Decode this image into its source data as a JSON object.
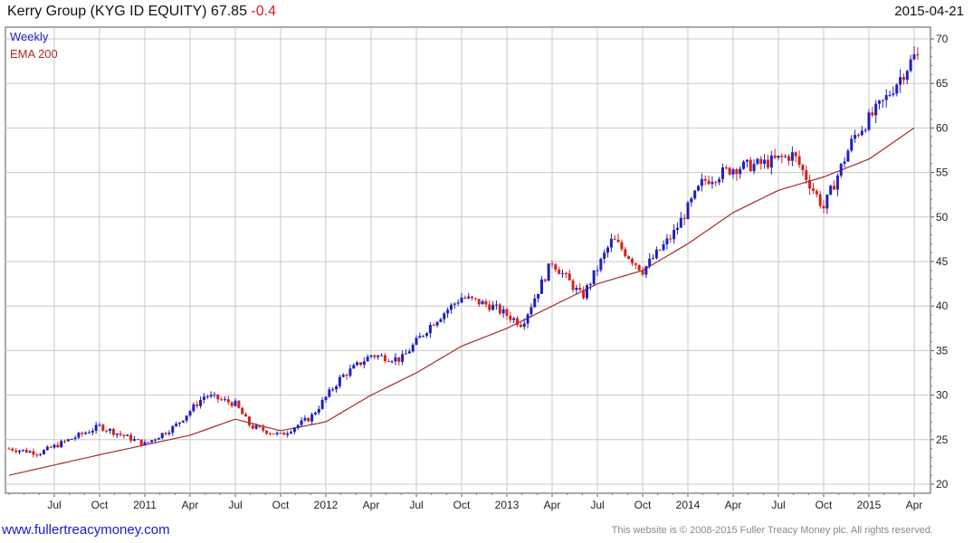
{
  "header": {
    "symbol_text": "Kerry Group (KYG ID EQUITY) 67.85",
    "change_text": "-0.4",
    "date": "2015-04-21"
  },
  "footer": {
    "website": "www.fullertreacymoney.com",
    "copyright": "This website is © 2008-2015 Fuller Treacy Money plc. All rights reserved."
  },
  "colors": {
    "up_candle": "#1f1fbf",
    "down_candle": "#d42020",
    "ema_line": "#a52a2a",
    "grid": "#c8c8c8",
    "frame": "#555555"
  },
  "chart_data": {
    "type": "candlestick",
    "title": "Kerry Group (KYG ID EQUITY) 67.85 -0.4",
    "frequency": "Weekly",
    "legend": [
      {
        "name": "Weekly",
        "color": "#1f1fbf"
      },
      {
        "name": "EMA 200",
        "color": "#a52a2a"
      }
    ],
    "legend_position": "top-left",
    "grid": true,
    "y_axis_side": "right",
    "ylim": [
      20,
      70
    ],
    "yticks": [
      20,
      25,
      30,
      35,
      40,
      45,
      50,
      55,
      60,
      65,
      70
    ],
    "x_tick_labels": [
      "Jul",
      "Oct",
      "2011",
      "Apr",
      "Jul",
      "Oct",
      "2012",
      "Apr",
      "Jul",
      "Oct",
      "2013",
      "Apr",
      "Jul",
      "Oct",
      "2014",
      "Apr",
      "Jul",
      "Oct",
      "2015",
      "Apr"
    ],
    "x_start": "2010-04",
    "x_end": "2015-04",
    "series": [
      {
        "name": "Weekly",
        "kind": "price_close_anchors",
        "dates": [
          "2010-04",
          "2010-06",
          "2010-08",
          "2010-10",
          "2011-01",
          "2011-03",
          "2011-05",
          "2011-07",
          "2011-08",
          "2011-10",
          "2011-12",
          "2012-02",
          "2012-04",
          "2012-06",
          "2012-08",
          "2012-10",
          "2012-12",
          "2013-02",
          "2013-04",
          "2013-06",
          "2013-08",
          "2013-10",
          "2013-12",
          "2014-02",
          "2014-04",
          "2014-06",
          "2014-08",
          "2014-10",
          "2014-12",
          "2015-02",
          "2015-04"
        ],
        "values": [
          24,
          23.5,
          25,
          26.5,
          24.5,
          26.5,
          30,
          29,
          26.5,
          25.5,
          27.5,
          32,
          34.5,
          34,
          38,
          41,
          40,
          38,
          45,
          41,
          47.5,
          44,
          48,
          54,
          55.5,
          56,
          57,
          51,
          59,
          63,
          68
        ]
      },
      {
        "name": "EMA 200",
        "kind": "line",
        "dates": [
          "2010-04",
          "2010-10",
          "2011-04",
          "2011-07",
          "2011-10",
          "2012-01",
          "2012-04",
          "2012-07",
          "2012-10",
          "2013-01",
          "2013-04",
          "2013-07",
          "2013-10",
          "2014-01",
          "2014-04",
          "2014-07",
          "2014-10",
          "2015-01",
          "2015-04"
        ],
        "values": [
          21,
          23.3,
          25.5,
          27.3,
          26,
          27,
          30,
          32.5,
          35.5,
          37.5,
          40,
          42.5,
          44,
          47,
          50.5,
          53,
          54.5,
          56.5,
          60
        ]
      }
    ]
  }
}
